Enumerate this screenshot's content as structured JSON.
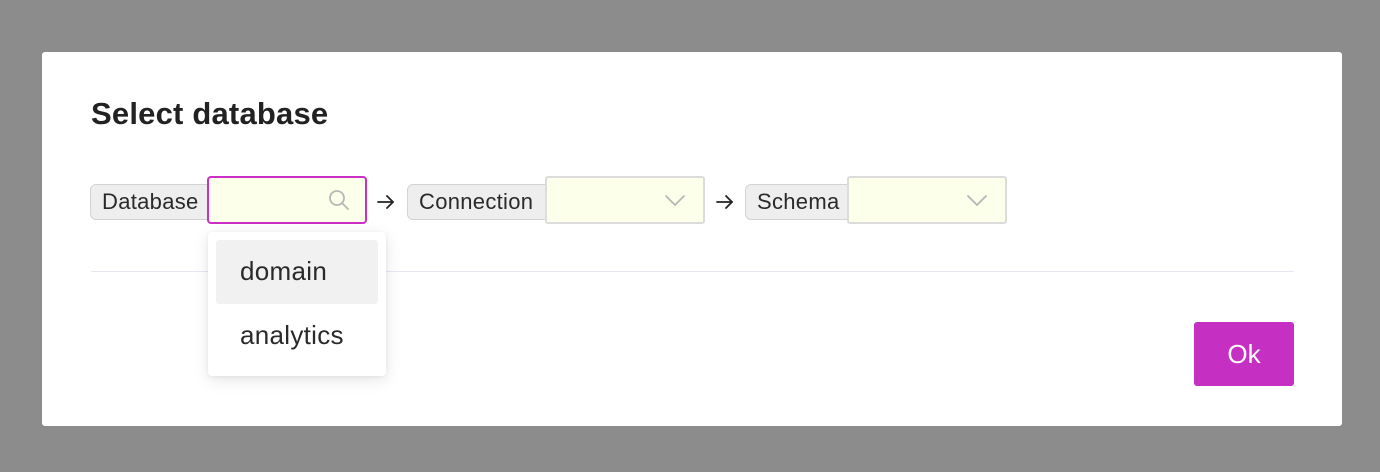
{
  "dialog": {
    "title": "Select database",
    "ok_label": "Ok"
  },
  "selectors": {
    "database": {
      "label": "Database",
      "value": "",
      "icon": "search-icon"
    },
    "connection": {
      "label": "Connection",
      "value": "",
      "icon": "chevron-down-icon"
    },
    "schema": {
      "label": "Schema",
      "value": "",
      "icon": "chevron-down-icon"
    },
    "separator_icon": "arrow-right-icon"
  },
  "dropdown": {
    "items": [
      {
        "label": "domain",
        "highlighted": true
      },
      {
        "label": "analytics",
        "highlighted": false
      }
    ]
  },
  "colors": {
    "accent": "#c52fc2",
    "field_background": "#fcffe9",
    "chip_background": "#eeeeee",
    "overlay": "#8c8c8c"
  }
}
